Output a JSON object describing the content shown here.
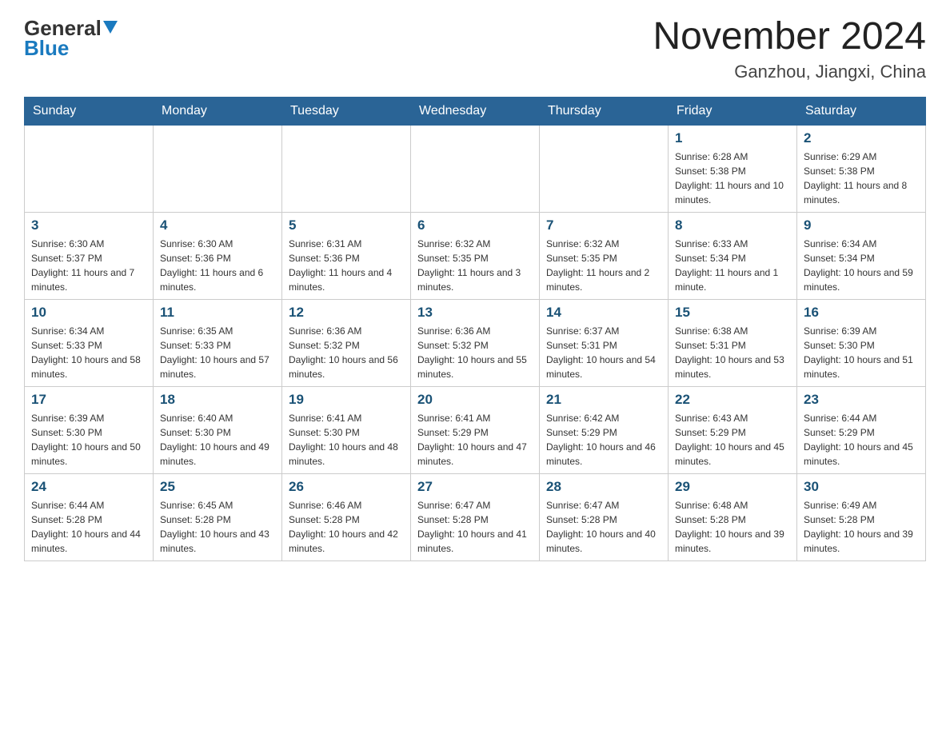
{
  "header": {
    "logo_line1": "General",
    "logo_line2": "Blue",
    "month_title": "November 2024",
    "location": "Ganzhou, Jiangxi, China"
  },
  "calendar": {
    "days_of_week": [
      "Sunday",
      "Monday",
      "Tuesday",
      "Wednesday",
      "Thursday",
      "Friday",
      "Saturday"
    ],
    "weeks": [
      [
        {
          "day": "",
          "info": ""
        },
        {
          "day": "",
          "info": ""
        },
        {
          "day": "",
          "info": ""
        },
        {
          "day": "",
          "info": ""
        },
        {
          "day": "",
          "info": ""
        },
        {
          "day": "1",
          "info": "Sunrise: 6:28 AM\nSunset: 5:38 PM\nDaylight: 11 hours and 10 minutes."
        },
        {
          "day": "2",
          "info": "Sunrise: 6:29 AM\nSunset: 5:38 PM\nDaylight: 11 hours and 8 minutes."
        }
      ],
      [
        {
          "day": "3",
          "info": "Sunrise: 6:30 AM\nSunset: 5:37 PM\nDaylight: 11 hours and 7 minutes."
        },
        {
          "day": "4",
          "info": "Sunrise: 6:30 AM\nSunset: 5:36 PM\nDaylight: 11 hours and 6 minutes."
        },
        {
          "day": "5",
          "info": "Sunrise: 6:31 AM\nSunset: 5:36 PM\nDaylight: 11 hours and 4 minutes."
        },
        {
          "day": "6",
          "info": "Sunrise: 6:32 AM\nSunset: 5:35 PM\nDaylight: 11 hours and 3 minutes."
        },
        {
          "day": "7",
          "info": "Sunrise: 6:32 AM\nSunset: 5:35 PM\nDaylight: 11 hours and 2 minutes."
        },
        {
          "day": "8",
          "info": "Sunrise: 6:33 AM\nSunset: 5:34 PM\nDaylight: 11 hours and 1 minute."
        },
        {
          "day": "9",
          "info": "Sunrise: 6:34 AM\nSunset: 5:34 PM\nDaylight: 10 hours and 59 minutes."
        }
      ],
      [
        {
          "day": "10",
          "info": "Sunrise: 6:34 AM\nSunset: 5:33 PM\nDaylight: 10 hours and 58 minutes."
        },
        {
          "day": "11",
          "info": "Sunrise: 6:35 AM\nSunset: 5:33 PM\nDaylight: 10 hours and 57 minutes."
        },
        {
          "day": "12",
          "info": "Sunrise: 6:36 AM\nSunset: 5:32 PM\nDaylight: 10 hours and 56 minutes."
        },
        {
          "day": "13",
          "info": "Sunrise: 6:36 AM\nSunset: 5:32 PM\nDaylight: 10 hours and 55 minutes."
        },
        {
          "day": "14",
          "info": "Sunrise: 6:37 AM\nSunset: 5:31 PM\nDaylight: 10 hours and 54 minutes."
        },
        {
          "day": "15",
          "info": "Sunrise: 6:38 AM\nSunset: 5:31 PM\nDaylight: 10 hours and 53 minutes."
        },
        {
          "day": "16",
          "info": "Sunrise: 6:39 AM\nSunset: 5:30 PM\nDaylight: 10 hours and 51 minutes."
        }
      ],
      [
        {
          "day": "17",
          "info": "Sunrise: 6:39 AM\nSunset: 5:30 PM\nDaylight: 10 hours and 50 minutes."
        },
        {
          "day": "18",
          "info": "Sunrise: 6:40 AM\nSunset: 5:30 PM\nDaylight: 10 hours and 49 minutes."
        },
        {
          "day": "19",
          "info": "Sunrise: 6:41 AM\nSunset: 5:30 PM\nDaylight: 10 hours and 48 minutes."
        },
        {
          "day": "20",
          "info": "Sunrise: 6:41 AM\nSunset: 5:29 PM\nDaylight: 10 hours and 47 minutes."
        },
        {
          "day": "21",
          "info": "Sunrise: 6:42 AM\nSunset: 5:29 PM\nDaylight: 10 hours and 46 minutes."
        },
        {
          "day": "22",
          "info": "Sunrise: 6:43 AM\nSunset: 5:29 PM\nDaylight: 10 hours and 45 minutes."
        },
        {
          "day": "23",
          "info": "Sunrise: 6:44 AM\nSunset: 5:29 PM\nDaylight: 10 hours and 45 minutes."
        }
      ],
      [
        {
          "day": "24",
          "info": "Sunrise: 6:44 AM\nSunset: 5:28 PM\nDaylight: 10 hours and 44 minutes."
        },
        {
          "day": "25",
          "info": "Sunrise: 6:45 AM\nSunset: 5:28 PM\nDaylight: 10 hours and 43 minutes."
        },
        {
          "day": "26",
          "info": "Sunrise: 6:46 AM\nSunset: 5:28 PM\nDaylight: 10 hours and 42 minutes."
        },
        {
          "day": "27",
          "info": "Sunrise: 6:47 AM\nSunset: 5:28 PM\nDaylight: 10 hours and 41 minutes."
        },
        {
          "day": "28",
          "info": "Sunrise: 6:47 AM\nSunset: 5:28 PM\nDaylight: 10 hours and 40 minutes."
        },
        {
          "day": "29",
          "info": "Sunrise: 6:48 AM\nSunset: 5:28 PM\nDaylight: 10 hours and 39 minutes."
        },
        {
          "day": "30",
          "info": "Sunrise: 6:49 AM\nSunset: 5:28 PM\nDaylight: 10 hours and 39 minutes."
        }
      ]
    ]
  }
}
